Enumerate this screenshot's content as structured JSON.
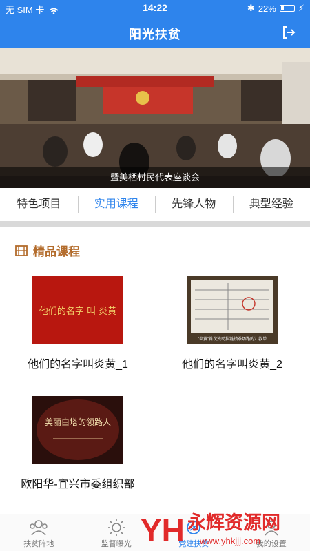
{
  "status": {
    "carrier": "无 SIM 卡",
    "time": "14:22",
    "battery": "22%"
  },
  "nav": {
    "title": "阳光扶贫"
  },
  "banner": {
    "caption": "暨美栖村民代表座谈会"
  },
  "tabs": [
    {
      "label": "特色项目"
    },
    {
      "label": "实用课程"
    },
    {
      "label": "先锋人物"
    },
    {
      "label": "典型经验"
    }
  ],
  "section": {
    "title": "精品课程"
  },
  "courses": [
    {
      "title": "他们的名字叫炎黄_1",
      "thumb_text": "他们的名字 叫 炎黄"
    },
    {
      "title": "他们的名字叫炎黄_2",
      "thumb_text": "\"炎黄\"首次资助拉链镇茶场路的汇款单"
    },
    {
      "title": "欧阳华-宜兴市委组织部",
      "thumb_text": "美丽白塔的领路人"
    }
  ],
  "tabbar": [
    {
      "label": "扶贫阵地",
      "icon": "people-icon"
    },
    {
      "label": "监督曝光",
      "icon": "sun-icon"
    },
    {
      "label": "党建扶贫",
      "icon": "party-icon"
    },
    {
      "label": "我的设置",
      "icon": "user-icon"
    }
  ],
  "watermark": {
    "brand": "永辉资源网",
    "url": "www.yhkjjj.com"
  },
  "colors": {
    "primary": "#2e84ec",
    "section_title": "#b36c2c"
  }
}
